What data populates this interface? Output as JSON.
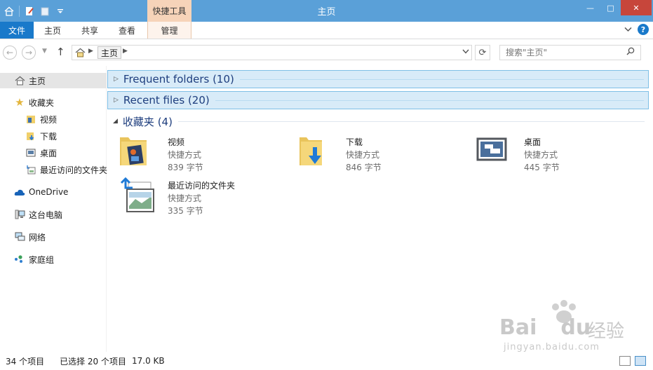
{
  "window": {
    "title": "主页",
    "minimize": "—",
    "maximize": "□",
    "close": "✕"
  },
  "ribbon": {
    "context_header": "快捷工具",
    "tabs": [
      {
        "label": "文件"
      },
      {
        "label": "主页"
      },
      {
        "label": "共享"
      },
      {
        "label": "查看"
      },
      {
        "label": "管理"
      }
    ],
    "expand_icon": "chevron-down-icon",
    "help": "?"
  },
  "address": {
    "crumb": "主页",
    "search_placeholder": "搜索\"主页\""
  },
  "sidebar": {
    "items": [
      {
        "label": "主页",
        "icon": "home-icon"
      },
      {
        "label": "收藏夹",
        "icon": "star-icon"
      },
      {
        "label": "视频",
        "icon": "video-folder-icon"
      },
      {
        "label": "下载",
        "icon": "download-folder-icon"
      },
      {
        "label": "桌面",
        "icon": "desktop-icon"
      },
      {
        "label": "最近访问的文件夹",
        "icon": "recent-folder-icon"
      },
      {
        "label": "OneDrive",
        "icon": "cloud-icon"
      },
      {
        "label": "这台电脑",
        "icon": "computer-icon"
      },
      {
        "label": "网络",
        "icon": "network-icon"
      },
      {
        "label": "家庭组",
        "icon": "homegroup-icon"
      }
    ]
  },
  "main": {
    "groups": [
      {
        "label": "Frequent folders (10)"
      },
      {
        "label": "Recent files (20)"
      },
      {
        "label": "收藏夹 (4)"
      }
    ],
    "favorites": [
      {
        "name": "视频",
        "type": "快捷方式",
        "size": "839 字节",
        "icon": "video-folder-icon"
      },
      {
        "name": "下载",
        "type": "快捷方式",
        "size": "846 字节",
        "icon": "download-folder-icon"
      },
      {
        "name": "桌面",
        "type": "快捷方式",
        "size": "445 字节",
        "icon": "desktop-icon"
      },
      {
        "name": "最近访问的文件夹",
        "type": "快捷方式",
        "size": "335 字节",
        "icon": "recent-folder-icon"
      }
    ]
  },
  "status": {
    "count": "34 个项目",
    "selection": "已选择 20 个项目",
    "size": "17.0 KB"
  },
  "watermark": {
    "brand": "Bai",
    "brand2": "du",
    "cn": "经验",
    "url": "jingyan.baidu.com"
  },
  "colors": {
    "titlebar": "#5aa0d8",
    "file_tab": "#1979ca",
    "context_tab": "#f6d3b9",
    "group_header": "#d8ebf8",
    "close": "#c7463b"
  }
}
